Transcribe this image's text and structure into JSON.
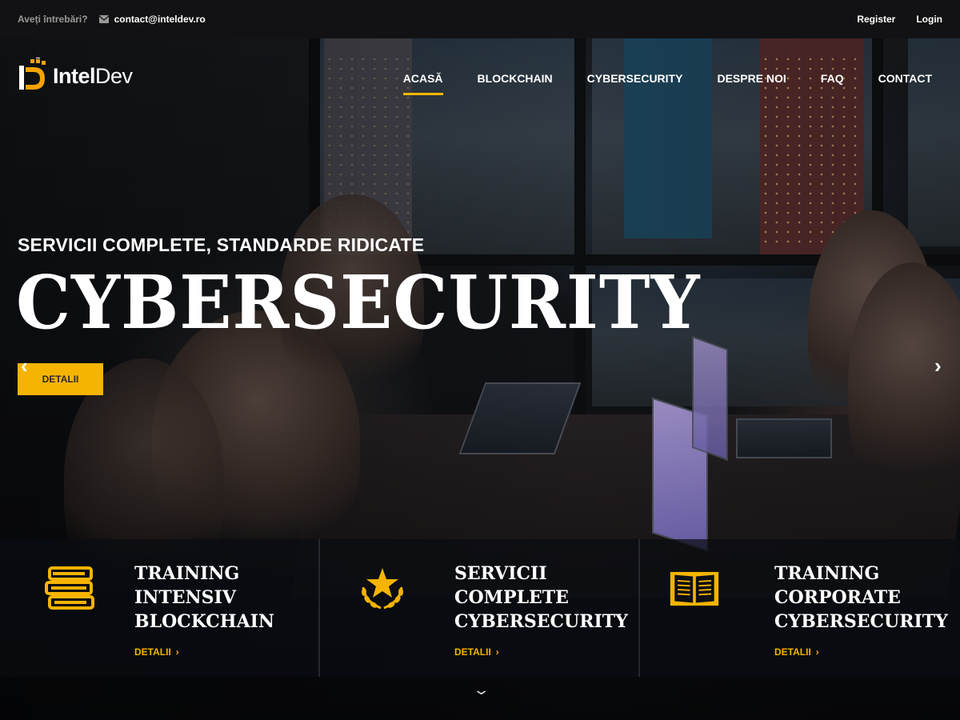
{
  "topbar": {
    "question": "Aveți întrebări?",
    "email": "contact@inteldev.ro",
    "register": "Register",
    "login": "Login"
  },
  "logo": {
    "brand_a": "Intel",
    "brand_b": "Dev"
  },
  "nav": {
    "items": [
      {
        "label": "ACASĂ",
        "active": true
      },
      {
        "label": "BLOCKCHAIN",
        "active": false
      },
      {
        "label": "CYBERSECURITY",
        "active": false
      },
      {
        "label": "DESPRE NOI",
        "active": false
      },
      {
        "label": "FAQ",
        "active": false
      },
      {
        "label": "CONTACT",
        "active": false
      }
    ]
  },
  "hero": {
    "subtitle": "SERVICII COMPLETE, STANDARDE RIDICATE",
    "title": "CYBERSECURITY",
    "button": "DETALII",
    "prev_glyph": "‹",
    "next_glyph": "›"
  },
  "features": [
    {
      "icon": "books-icon",
      "title": "TRAINING INTENSIV BLOCKCHAIN",
      "link": "DETALII"
    },
    {
      "icon": "laurel-star-icon",
      "title": "SERVICII COMPLETE CYBERSECURITY",
      "link": "DETALII"
    },
    {
      "icon": "open-book-icon",
      "title": "TRAINING CORPORATE CYBERSECURITY",
      "link": "DETALII"
    }
  ],
  "colors": {
    "accent": "#f5b400",
    "topbar": "#121214"
  }
}
